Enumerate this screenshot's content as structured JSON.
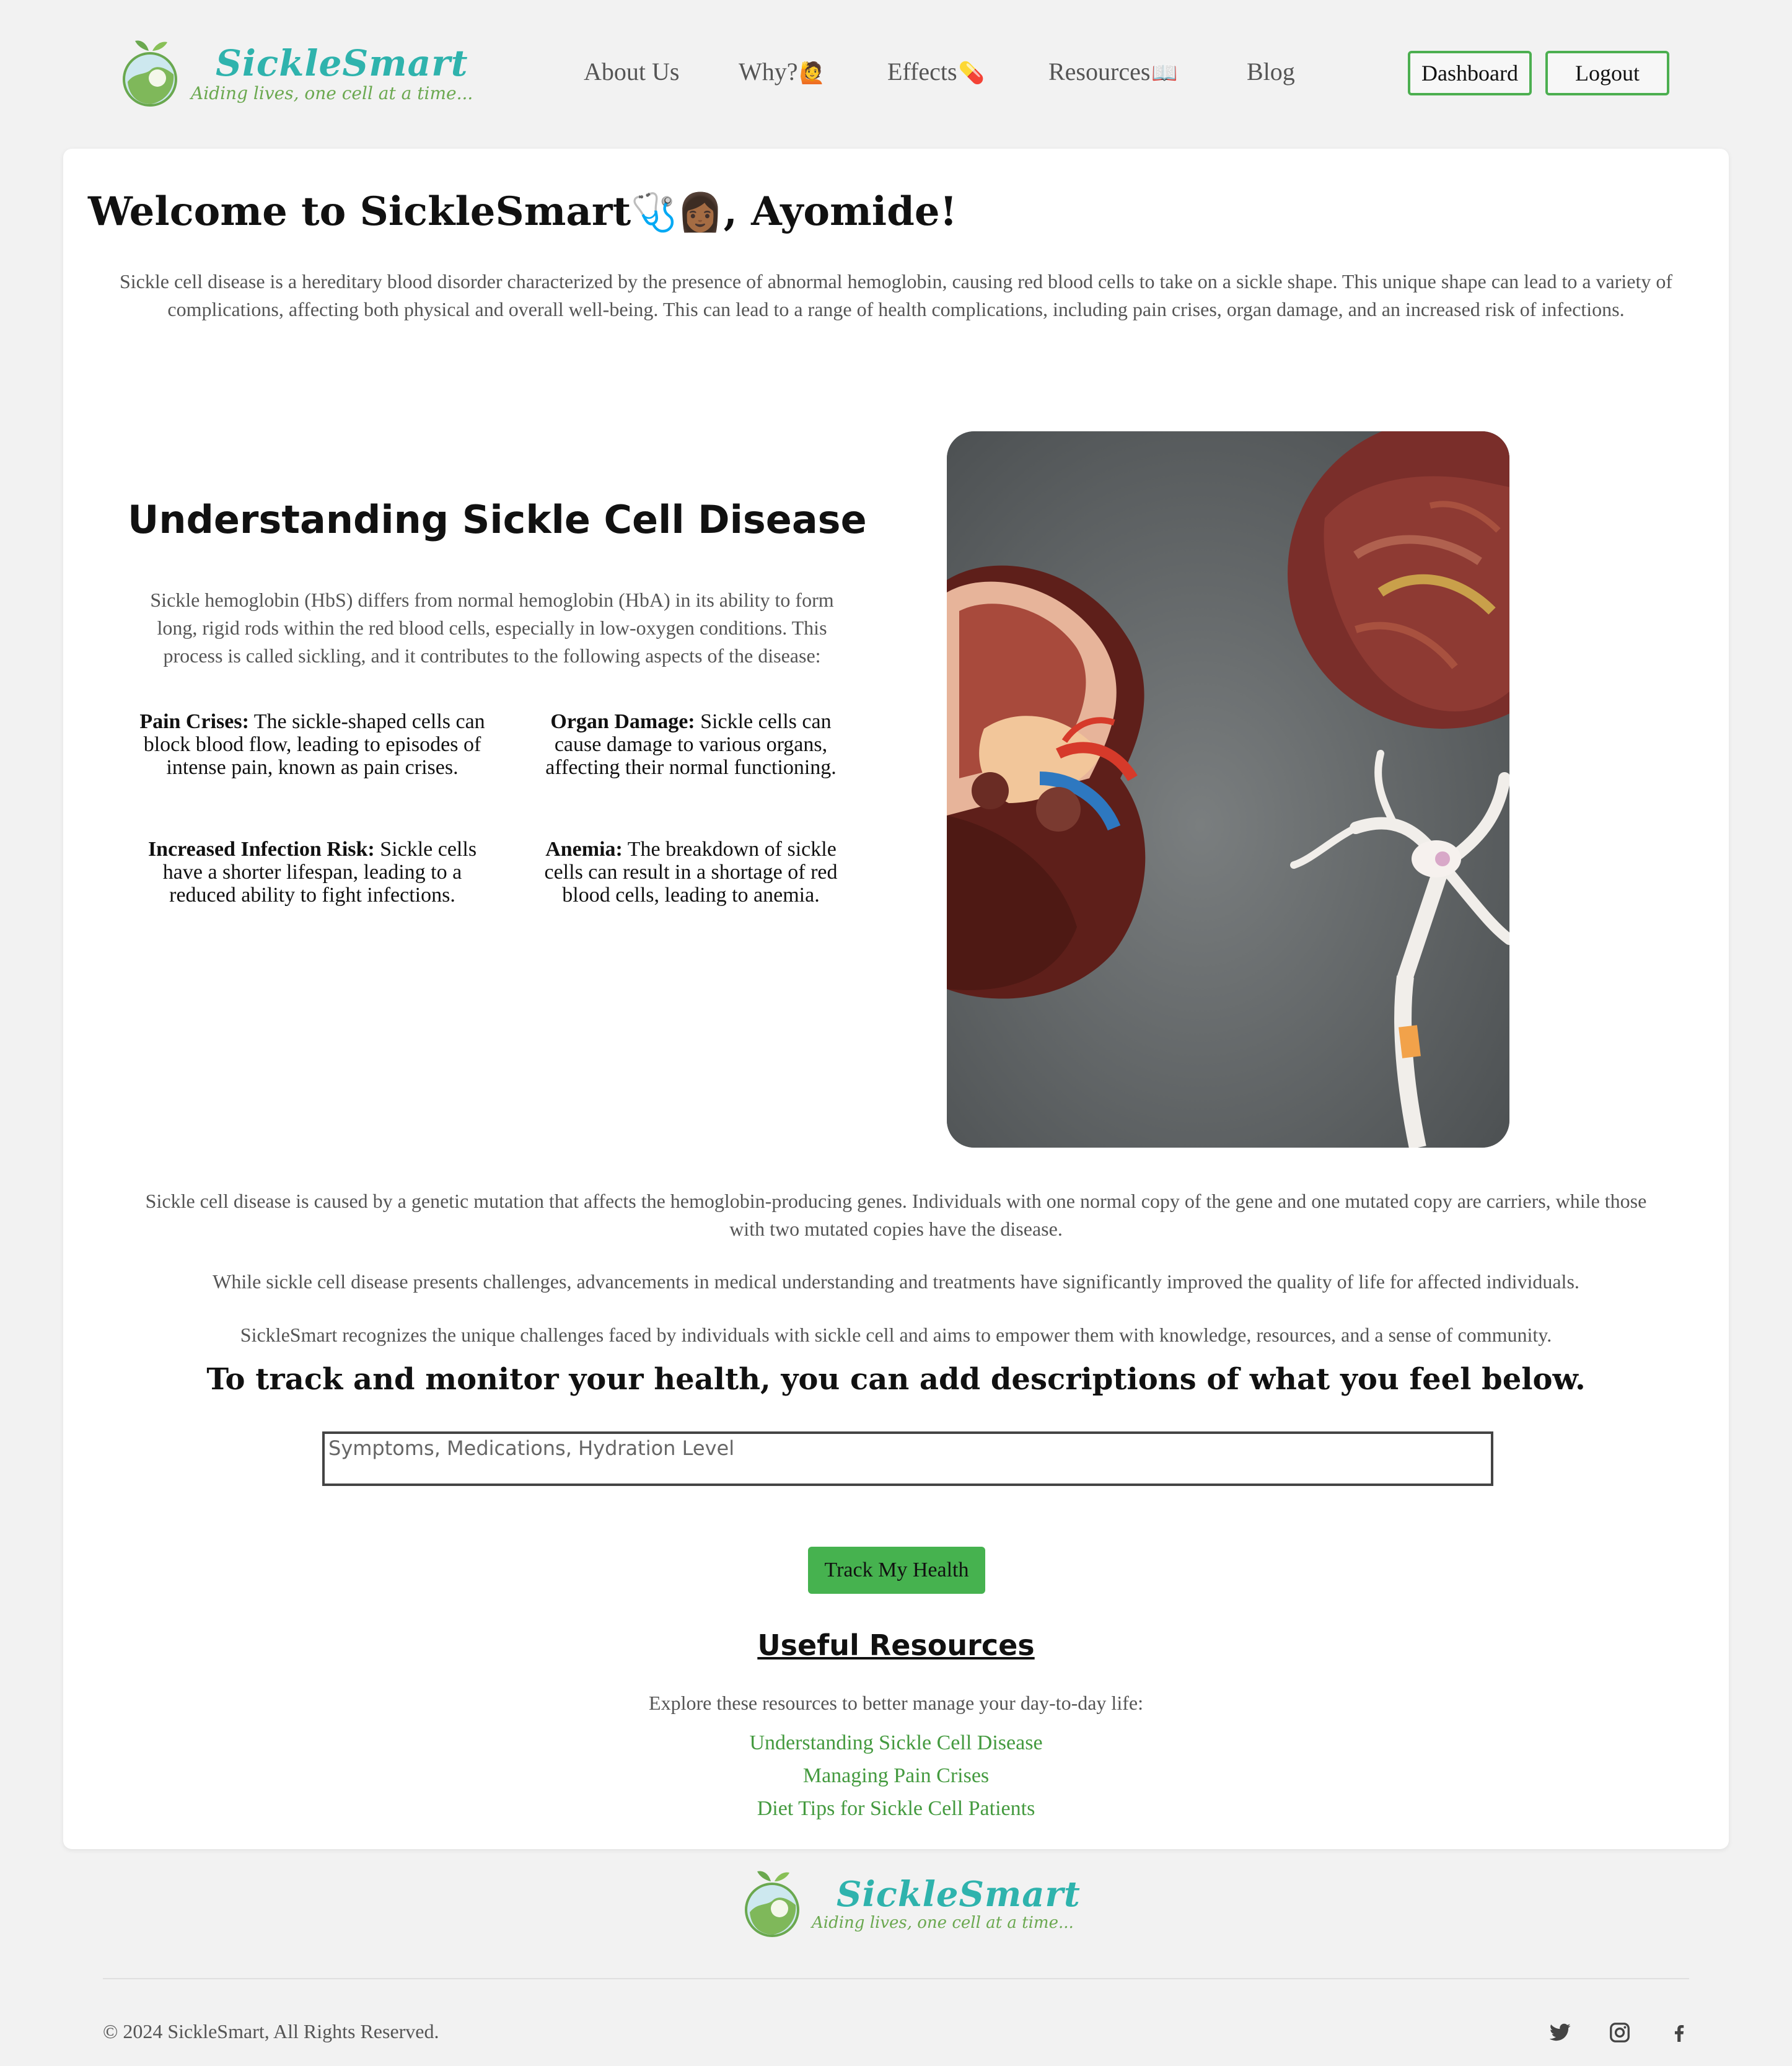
{
  "brand": {
    "name": "SickleSmart",
    "tagline": "Aiding lives, one cell at a time..."
  },
  "nav": {
    "items": [
      {
        "label": "About Us",
        "emoji": ""
      },
      {
        "label": "Why?",
        "emoji": "🙋"
      },
      {
        "label": "Effects",
        "emoji": "💊"
      },
      {
        "label": "Resources",
        "emoji": "📖"
      },
      {
        "label": "Blog",
        "emoji": ""
      }
    ],
    "dashboard_label": "Dashboard",
    "logout_label": "Logout"
  },
  "welcome": {
    "prefix": "Welcome to SickleSmart",
    "emoji": "🩺👩🏾",
    "suffix": ", Ayomide!"
  },
  "intro": "Sickle cell disease is a hereditary blood disorder characterized by the presence of abnormal hemoglobin, causing red blood cells to take on a sickle shape. This unique shape can lead to a variety of complications, affecting both physical and overall well-being. This can lead to a range of health complications, including pain crises, organ damage, and an increased risk of infections.",
  "understanding": {
    "heading": "Understanding Sickle Cell Disease",
    "text": "Sickle hemoglobin (HbS) differs from normal hemoglobin (HbA) in its ability to form long, rigid rods within the red blood cells, especially in low-oxygen conditions. This process is called sickling, and it contributes to the following aspects of the disease:",
    "aspects": [
      {
        "title": "Pain Crises:",
        "text": " The sickle-shaped cells can block blood flow, leading to episodes of intense pain, known as pain crises."
      },
      {
        "title": "Organ Damage:",
        "text": " Sickle cells can cause damage to various organs, affecting their normal functioning."
      },
      {
        "title": "Increased Infection Risk:",
        "text": " Sickle cells have a shorter lifespan, leading to a reduced ability to fight infections."
      },
      {
        "title": "Anemia:",
        "text": " The breakdown of sickle cells can result in a shortage of red blood cells, leading to anemia."
      }
    ]
  },
  "paragraphs": [
    "Sickle cell disease is caused by a genetic mutation that affects the hemoglobin-producing genes. Individuals with one normal copy of the gene and one mutated copy are carriers, while those with two mutated copies have the disease.",
    "While sickle cell disease presents challenges, advancements in medical understanding and treatments have significantly improved the quality of life for affected individuals.",
    "SickleSmart recognizes the unique challenges faced by individuals with sickle cell and aims to empower them with knowledge, resources, and a sense of community."
  ],
  "tracker": {
    "heading": "To track and monitor your health, you can add descriptions of what you feel below.",
    "placeholder": "Symptoms, Medications, Hydration Level",
    "value": "",
    "button_label": "Track My Health"
  },
  "resources": {
    "heading": "Useful Resources",
    "intro": "Explore these resources to better manage your day-to-day life:",
    "links": [
      "Understanding Sickle Cell Disease",
      "Managing Pain Crises",
      "Diet Tips for Sickle Cell Patients"
    ]
  },
  "footer": {
    "copyright": "© 2024 SickleSmart, All Rights Reserved.",
    "social_icons": [
      "twitter-icon",
      "instagram-icon",
      "facebook-icon"
    ]
  },
  "colors": {
    "accent_green": "#4caf50",
    "brand_teal": "#2fb3ad",
    "link_green": "#449a3f",
    "background": "#f2f2f2"
  }
}
